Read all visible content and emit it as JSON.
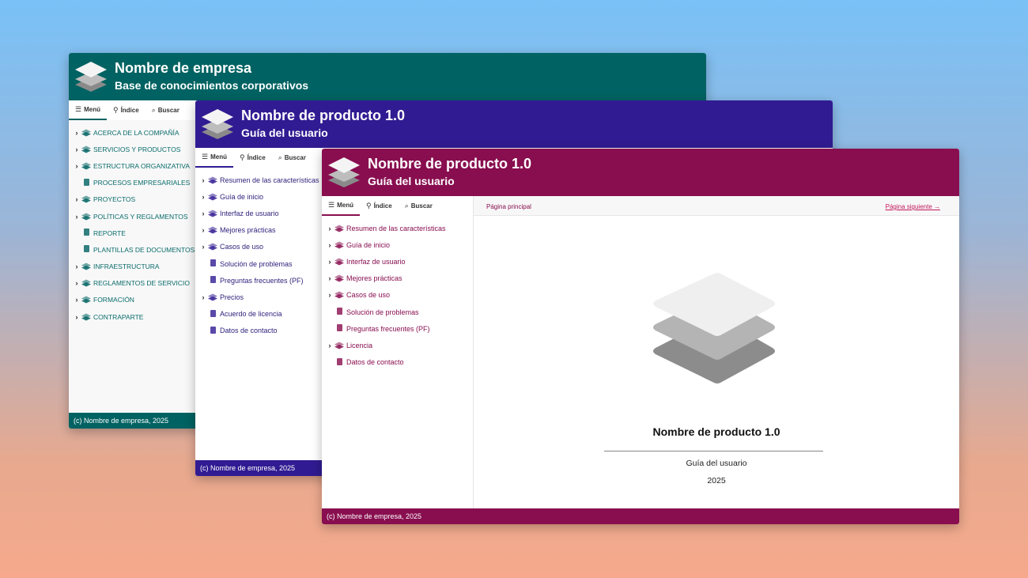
{
  "colors": {
    "teal": "#006262",
    "indigo": "#311b92",
    "magenta": "#880e4f"
  },
  "windows": [
    {
      "header": {
        "title": "Nombre de empresa",
        "subtitle": "Base de conocimientos corporativos"
      },
      "tabs": {
        "menu": "Menú",
        "index": "Índice",
        "search": "Buscar"
      },
      "nav": [
        {
          "label": "ACERCA DE LA COMPAÑÍA",
          "expandable": true,
          "icon": "book-icon"
        },
        {
          "label": "SERVICIOS Y PRODUCTOS",
          "expandable": true,
          "icon": "book-icon"
        },
        {
          "label": "ESTRUCTURA ORGANIZATIVA",
          "expandable": true,
          "icon": "book-icon"
        },
        {
          "label": "PROCESOS EMPRESARIALES",
          "expandable": false,
          "icon": "page-icon"
        },
        {
          "label": "PROYECTOS",
          "expandable": true,
          "icon": "book-icon"
        },
        {
          "label": "POLÍTICAS Y REGLAMENTOS",
          "expandable": true,
          "icon": "book-icon"
        },
        {
          "label": "REPORTE",
          "expandable": false,
          "icon": "page-icon"
        },
        {
          "label": "PLANTILLAS DE DOCUMENTOS",
          "expandable": false,
          "icon": "page-icon"
        },
        {
          "label": "INFRAESTRUCTURA",
          "expandable": true,
          "icon": "book-icon"
        },
        {
          "label": "REGLAMENTOS DE SERVICIO",
          "expandable": true,
          "icon": "book-icon"
        },
        {
          "label": "FORMACIÓN",
          "expandable": true,
          "icon": "book-icon"
        },
        {
          "label": "CONTRAPARTE",
          "expandable": true,
          "icon": "book-icon"
        }
      ],
      "footer": "(c) Nombre de empresa, 2025"
    },
    {
      "header": {
        "title": "Nombre de producto 1.0",
        "subtitle": "Guía del usuario"
      },
      "tabs": {
        "menu": "Menú",
        "index": "Índice",
        "search": "Buscar"
      },
      "nav": [
        {
          "label": "Resumen de las características",
          "expandable": true,
          "icon": "book-icon"
        },
        {
          "label": "Guía de inicio",
          "expandable": true,
          "icon": "book-icon"
        },
        {
          "label": "Interfaz de usuario",
          "expandable": true,
          "icon": "book-icon"
        },
        {
          "label": "Mejores prácticas",
          "expandable": true,
          "icon": "book-icon"
        },
        {
          "label": "Casos de uso",
          "expandable": true,
          "icon": "book-icon"
        },
        {
          "label": "Solución de problemas",
          "expandable": false,
          "icon": "page-icon"
        },
        {
          "label": "Preguntas frecuentes (PF)",
          "expandable": false,
          "icon": "page-icon"
        },
        {
          "label": "Precios",
          "expandable": true,
          "icon": "book-icon"
        },
        {
          "label": "Acuerdo de licencia",
          "expandable": false,
          "icon": "page-icon"
        },
        {
          "label": "Datos de contacto",
          "expandable": false,
          "icon": "page-icon"
        }
      ],
      "footer": "(c) Nombre de empresa, 2025"
    },
    {
      "header": {
        "title": "Nombre de producto 1.0",
        "subtitle": "Guía del usuario"
      },
      "tabs": {
        "menu": "Menú",
        "index": "Índice",
        "search": "Buscar"
      },
      "nav": [
        {
          "label": "Resumen de las características",
          "expandable": true,
          "icon": "book-icon"
        },
        {
          "label": "Guía de inicio",
          "expandable": true,
          "icon": "book-icon"
        },
        {
          "label": "Interfaz de usuario",
          "expandable": true,
          "icon": "book-icon"
        },
        {
          "label": "Mejores prácticas",
          "expandable": true,
          "icon": "book-icon"
        },
        {
          "label": "Casos de uso",
          "expandable": true,
          "icon": "book-icon"
        },
        {
          "label": "Solución de problemas",
          "expandable": false,
          "icon": "page-icon"
        },
        {
          "label": "Preguntas frecuentes (PF)",
          "expandable": false,
          "icon": "page-icon"
        },
        {
          "label": "Licencia",
          "expandable": true,
          "icon": "book-icon"
        },
        {
          "label": "Datos de contacto",
          "expandable": false,
          "icon": "page-icon"
        }
      ],
      "topbar": {
        "breadcrumb": "Página principal",
        "next": "Página siguiente →"
      },
      "cover": {
        "title": "Nombre de producto 1.0",
        "subtitle": "Guía del usuario",
        "year": "2025"
      },
      "footer": "(c) Nombre de empresa, 2025"
    }
  ]
}
